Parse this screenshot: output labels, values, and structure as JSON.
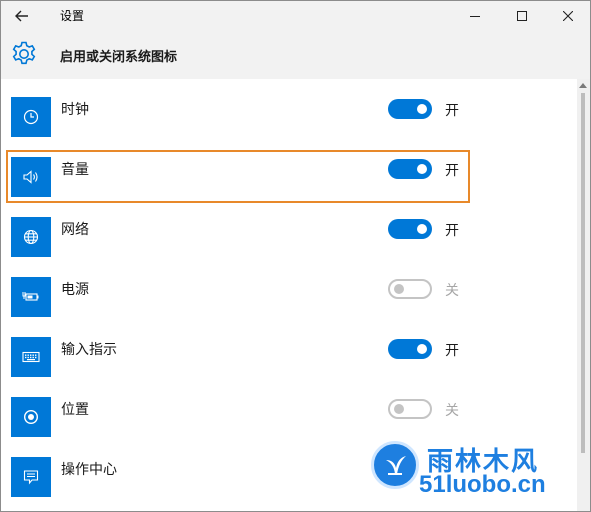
{
  "window": {
    "title": "设置",
    "controls": {
      "minimize_icon": "minimize-icon",
      "maximize_icon": "maximize-icon",
      "close_icon": "close-icon"
    }
  },
  "header": {
    "title": "启用或关闭系统图标",
    "icon": "gear-icon"
  },
  "colors": {
    "accent": "#0078d7",
    "highlight_border": "#e8892a",
    "chrome_bg": "#f2f2f2"
  },
  "items": [
    {
      "label": "时钟",
      "icon": "clock-icon",
      "on": true,
      "state_label": "开"
    },
    {
      "label": "音量",
      "icon": "volume-icon",
      "on": true,
      "state_label": "开"
    },
    {
      "label": "网络",
      "icon": "network-globe-icon",
      "on": true,
      "state_label": "开"
    },
    {
      "label": "电源",
      "icon": "power-battery-icon",
      "on": false,
      "state_label": "关"
    },
    {
      "label": "输入指示",
      "icon": "keyboard-icon",
      "on": true,
      "state_label": "开"
    },
    {
      "label": "位置",
      "icon": "location-icon",
      "on": false,
      "state_label": "关"
    },
    {
      "label": "操作中心",
      "icon": "action-center-icon"
    }
  ],
  "watermark": {
    "text_cn": "雨林木风",
    "text_en": "51luobo.cn"
  }
}
